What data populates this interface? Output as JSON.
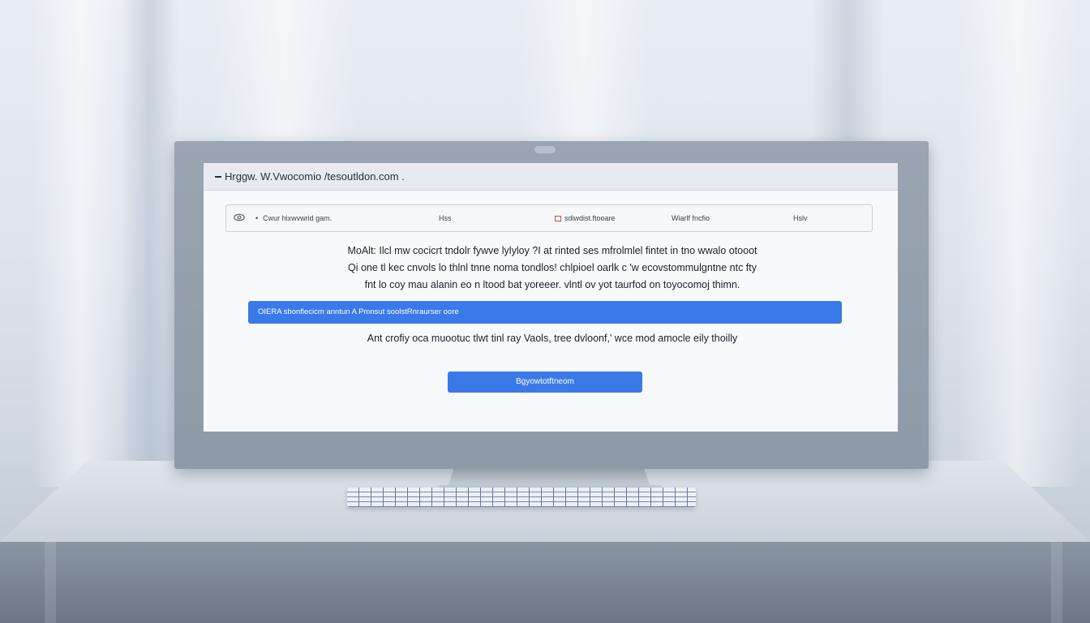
{
  "browser": {
    "url": "Hrggw. W.Vwocomio /tesoutldon.com ."
  },
  "nav": {
    "account_label": "Cwur hixwvwrid gam.",
    "item_2": "Hss",
    "item_3": "sdiwdist.ftooare",
    "item_4": "Wiarlf fncfio",
    "item_5": "Hslv"
  },
  "content": {
    "line_1": "MoAlt: Ilcl mw cocicrt tndolr fywve lylyloy ?I at rinted ses mfrolmlel fintet in tno wwalo otooot",
    "line_2": "Qi one tl kec cnvols lo thlnl tnne noma tondlos! chlpioel oarlk c 'w ecovstommulgntne ntc fty",
    "line_3": "fnt lo coy mau alanin eo n ltood bat yoreeer. vlntl ov yot taurfod on toyocomoj thimn.",
    "banner_text": "OIERA sbonflecicm anntun A Pmnsut soolstRnraurser oore",
    "note": "Ant crofiy oca muootuc tlwt tinl ray Vaols, tree dvloonf,' wce mod amocle eily thoilly",
    "button_label": "Bgyowtotftneom"
  },
  "colors": {
    "accent": "#3a7ae8",
    "error_icon": "#d9432f"
  },
  "icons": {
    "logo": "eye-icon",
    "nav_warning": "warning-square-icon"
  }
}
